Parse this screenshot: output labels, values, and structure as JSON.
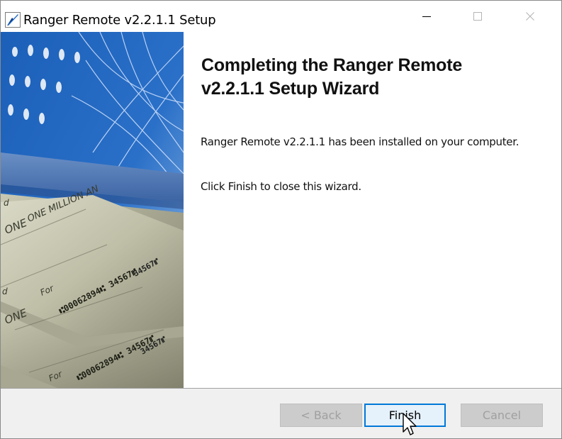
{
  "window": {
    "title": "Ranger Remote v2.2.1.1 Setup",
    "icon": "setup-app-icon",
    "controls": [
      "minimize-icon",
      "maximize-icon",
      "close-icon"
    ]
  },
  "side_image": {
    "description_icon": "checks-banner-image",
    "check_text_top": "ONE MILLION AN",
    "check_text_mid": "ONE",
    "check_micr_1": "⑆00062894⑆ 34567⑈",
    "check_micr_2": "⑆00062894⑆ 34567⑈",
    "check_for": "For",
    "check_symbol": "d",
    "check_symbol_2": "d"
  },
  "main": {
    "heading_line1": "Completing the Ranger Remote",
    "heading_line2": "v2.2.1.1 Setup Wizard",
    "installed_message": "Ranger Remote v2.2.1.1 has been installed on your computer.",
    "finish_message": "Click Finish to close this wizard."
  },
  "buttons": {
    "back": "< Back",
    "finish": "Finish",
    "cancel": "Cancel"
  },
  "colors": {
    "accent": "#0078d7",
    "footer_bg": "#f0f0f0",
    "disabled_text": "#a0a0a0"
  }
}
